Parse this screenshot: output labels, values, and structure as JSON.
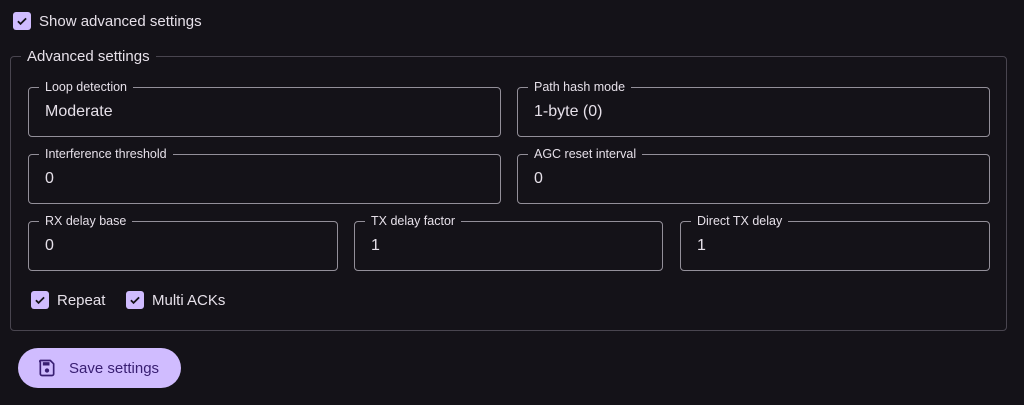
{
  "show_advanced": {
    "label": "Show advanced settings",
    "checked": true
  },
  "advanced": {
    "legend": "Advanced settings",
    "fields": [
      {
        "label": "Loop detection",
        "value": "Moderate"
      },
      {
        "label": "Path hash mode",
        "value": "1-byte (0)"
      },
      {
        "label": "Interference threshold",
        "value": "0"
      },
      {
        "label": "AGC reset interval",
        "value": "0"
      },
      {
        "label": "RX delay base",
        "value": "0"
      },
      {
        "label": "TX delay factor",
        "value": "1"
      },
      {
        "label": "Direct TX delay",
        "value": "1"
      }
    ],
    "checkboxes": [
      {
        "label": "Repeat",
        "checked": true
      },
      {
        "label": "Multi ACKs",
        "checked": true
      }
    ]
  },
  "save_button": {
    "label": "Save settings",
    "icon": "save-icon"
  },
  "colors": {
    "accent": "#d0bcff",
    "background": "#141218",
    "on_accent": "#381e72"
  }
}
